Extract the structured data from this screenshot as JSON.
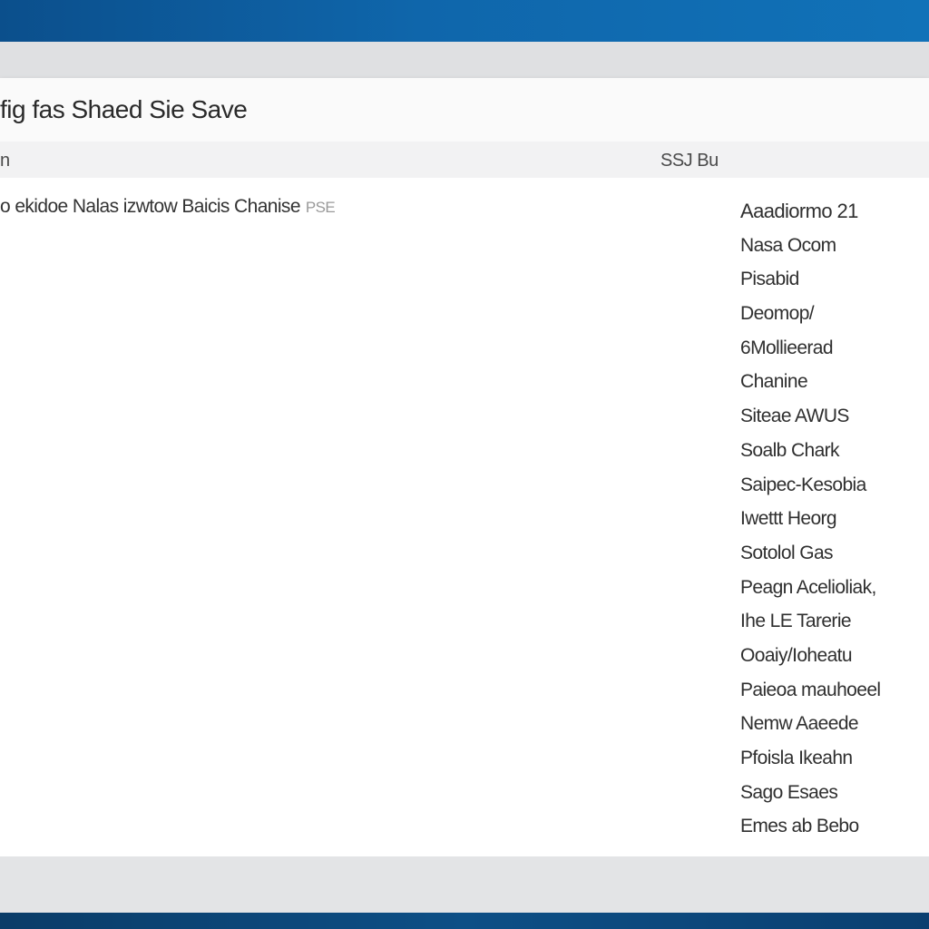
{
  "window": {
    "title": "fig fas Shaed Sie Save"
  },
  "columns": {
    "left": "n",
    "right": "SSJ Bu"
  },
  "main": {
    "line_text": "o ekidoe Nalas izwtow Baicis Chanise",
    "line_suffix": "PSE"
  },
  "sidebar": {
    "items": [
      "Aaadiormo 21",
      "Nasa Ocom",
      "Pisabid",
      "Deomop/",
      "6Mollieerad",
      "Chanine",
      "Siteae AWUS",
      "Soalb Chark",
      "Saipec-Kesobia",
      "Iwettt Heorg",
      "Sotolol Gas",
      "Peagn Acelioliak,",
      "Ihe LE Tarerie",
      "Ooaiy/Ioheatu",
      "Paieoa mauhoeel",
      "Nemw Aaeede",
      "Pfoisla Ikeahn",
      "Sago Esaes",
      "Emes ab Bebo"
    ]
  }
}
